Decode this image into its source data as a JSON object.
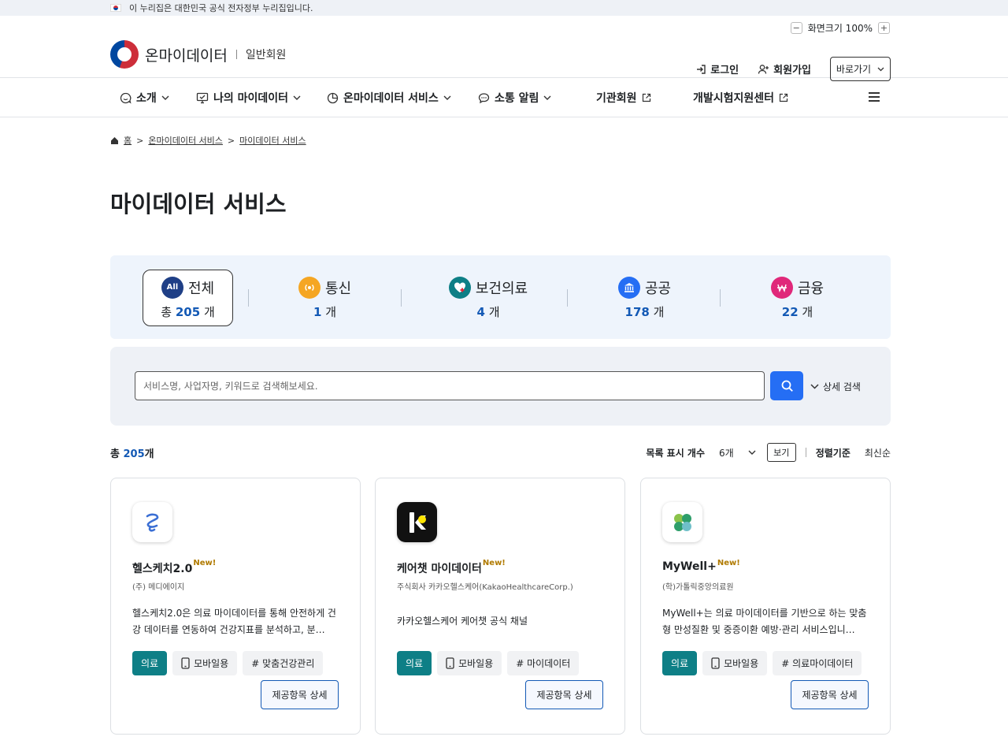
{
  "gov_banner": {
    "text": "이 누리집은 대한민국 공식 전자정부 누리집입니다."
  },
  "zoom": {
    "minus": "−",
    "label": "화면크기 100%",
    "plus": "+"
  },
  "header": {
    "logo_name": "온마이데이터",
    "logo_sub": "일반회원",
    "login": "로그인",
    "signup": "회원가입",
    "quick_link": "바로가기"
  },
  "nav": {
    "items": [
      {
        "label": "소개"
      },
      {
        "label": "나의 마이데이터"
      },
      {
        "label": "온마이데이터 서비스"
      },
      {
        "label": "소통 알림"
      },
      {
        "label": "기관회원"
      },
      {
        "label": "개발시험지원센터"
      }
    ]
  },
  "breadcrumb": {
    "home": "홈",
    "sep": ">",
    "level1": "온마이데이터 서비스",
    "level2": "마이데이터 서비스"
  },
  "page_title": "마이데이터 서비스",
  "categories": [
    {
      "name": "전체",
      "icon": "All",
      "prefix": "총",
      "count": "205",
      "unit": "개",
      "color": "#1f3f86"
    },
    {
      "name": "통신",
      "count": "1",
      "unit": "개",
      "color": "#f5a623"
    },
    {
      "name": "보건의료",
      "count": "4",
      "unit": "개",
      "color": "#0e7f86"
    },
    {
      "name": "공공",
      "count": "178",
      "unit": "개",
      "color": "#256ef4"
    },
    {
      "name": "금융",
      "count": "22",
      "unit": "개",
      "color": "#e0287a"
    }
  ],
  "search": {
    "placeholder": "서비스명, 사업자명, 키워드로 검색해보세요.",
    "advanced": "상세 검색"
  },
  "list": {
    "total_prefix": "총",
    "total_count": "205",
    "total_unit": "개",
    "page_size_label": "목록 표시 개수",
    "page_size_value": "6개",
    "view_button": "보기",
    "sort_label": "정렬기준",
    "sort_value": "최신순"
  },
  "cards": [
    {
      "title": "헬스케치2.0",
      "badge": "New!",
      "company": "(주) 메디에이지",
      "desc": "헬스케치2.0은 의료 마이데이터를 통해 안전하게 건강 데이터를 연동하여 건강지표를 분석하고, 분…",
      "tags": [
        "의료",
        "모바일용",
        "# 맞춤건강관리"
      ],
      "button": "제공항목 상세"
    },
    {
      "title": "케어챗 마이데이터",
      "badge": "New!",
      "company": "주식회사 카카오헬스케어(KakaoHealthcareCorp.)",
      "desc": "카카오헬스케어 케어챗 공식 채널",
      "tags": [
        "의료",
        "모바일용",
        "# 마이데이터"
      ],
      "button": "제공항목 상세"
    },
    {
      "title": "MyWell+",
      "badge": "New!",
      "company": "(학)가톨릭중앙의료원",
      "desc": "MyWell+는 의료 마이데이터를 기반으로 하는 맞춤형 만성질환 및 중증이환 예방·관리 서비스입니…",
      "tags": [
        "의료",
        "모바일용",
        "# 의료마이데이터"
      ],
      "button": "제공항목 상세"
    }
  ]
}
